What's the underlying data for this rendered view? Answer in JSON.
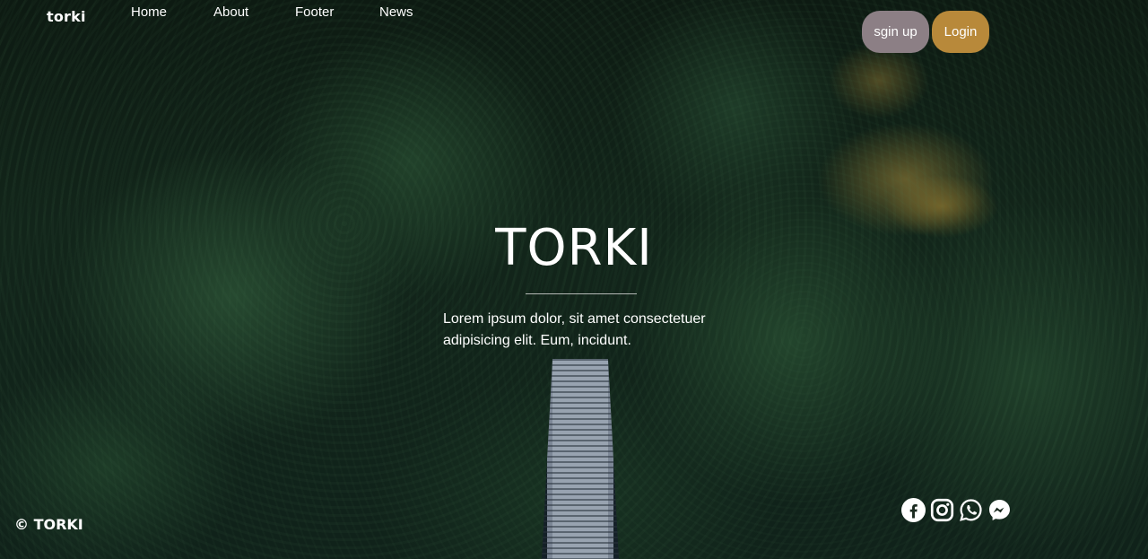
{
  "nav": {
    "brand": "torki",
    "links": [
      "Home",
      "About",
      "Footer",
      "News"
    ]
  },
  "auth": {
    "signup_label": "sgin up",
    "login_label": "Login"
  },
  "hero": {
    "title": "TORKI",
    "text": "Lorem ipsum dolor, sit amet consectetuer adipisicing elit. Eum, incidunt."
  },
  "footer": {
    "copyright": "© TORKI",
    "social": [
      "facebook-icon",
      "instagram-icon",
      "whatsapp-icon",
      "messenger-icon"
    ]
  },
  "colors": {
    "signup_bg": "#8c7f85",
    "login_bg": "#b8893a",
    "text": "#ffffff"
  }
}
